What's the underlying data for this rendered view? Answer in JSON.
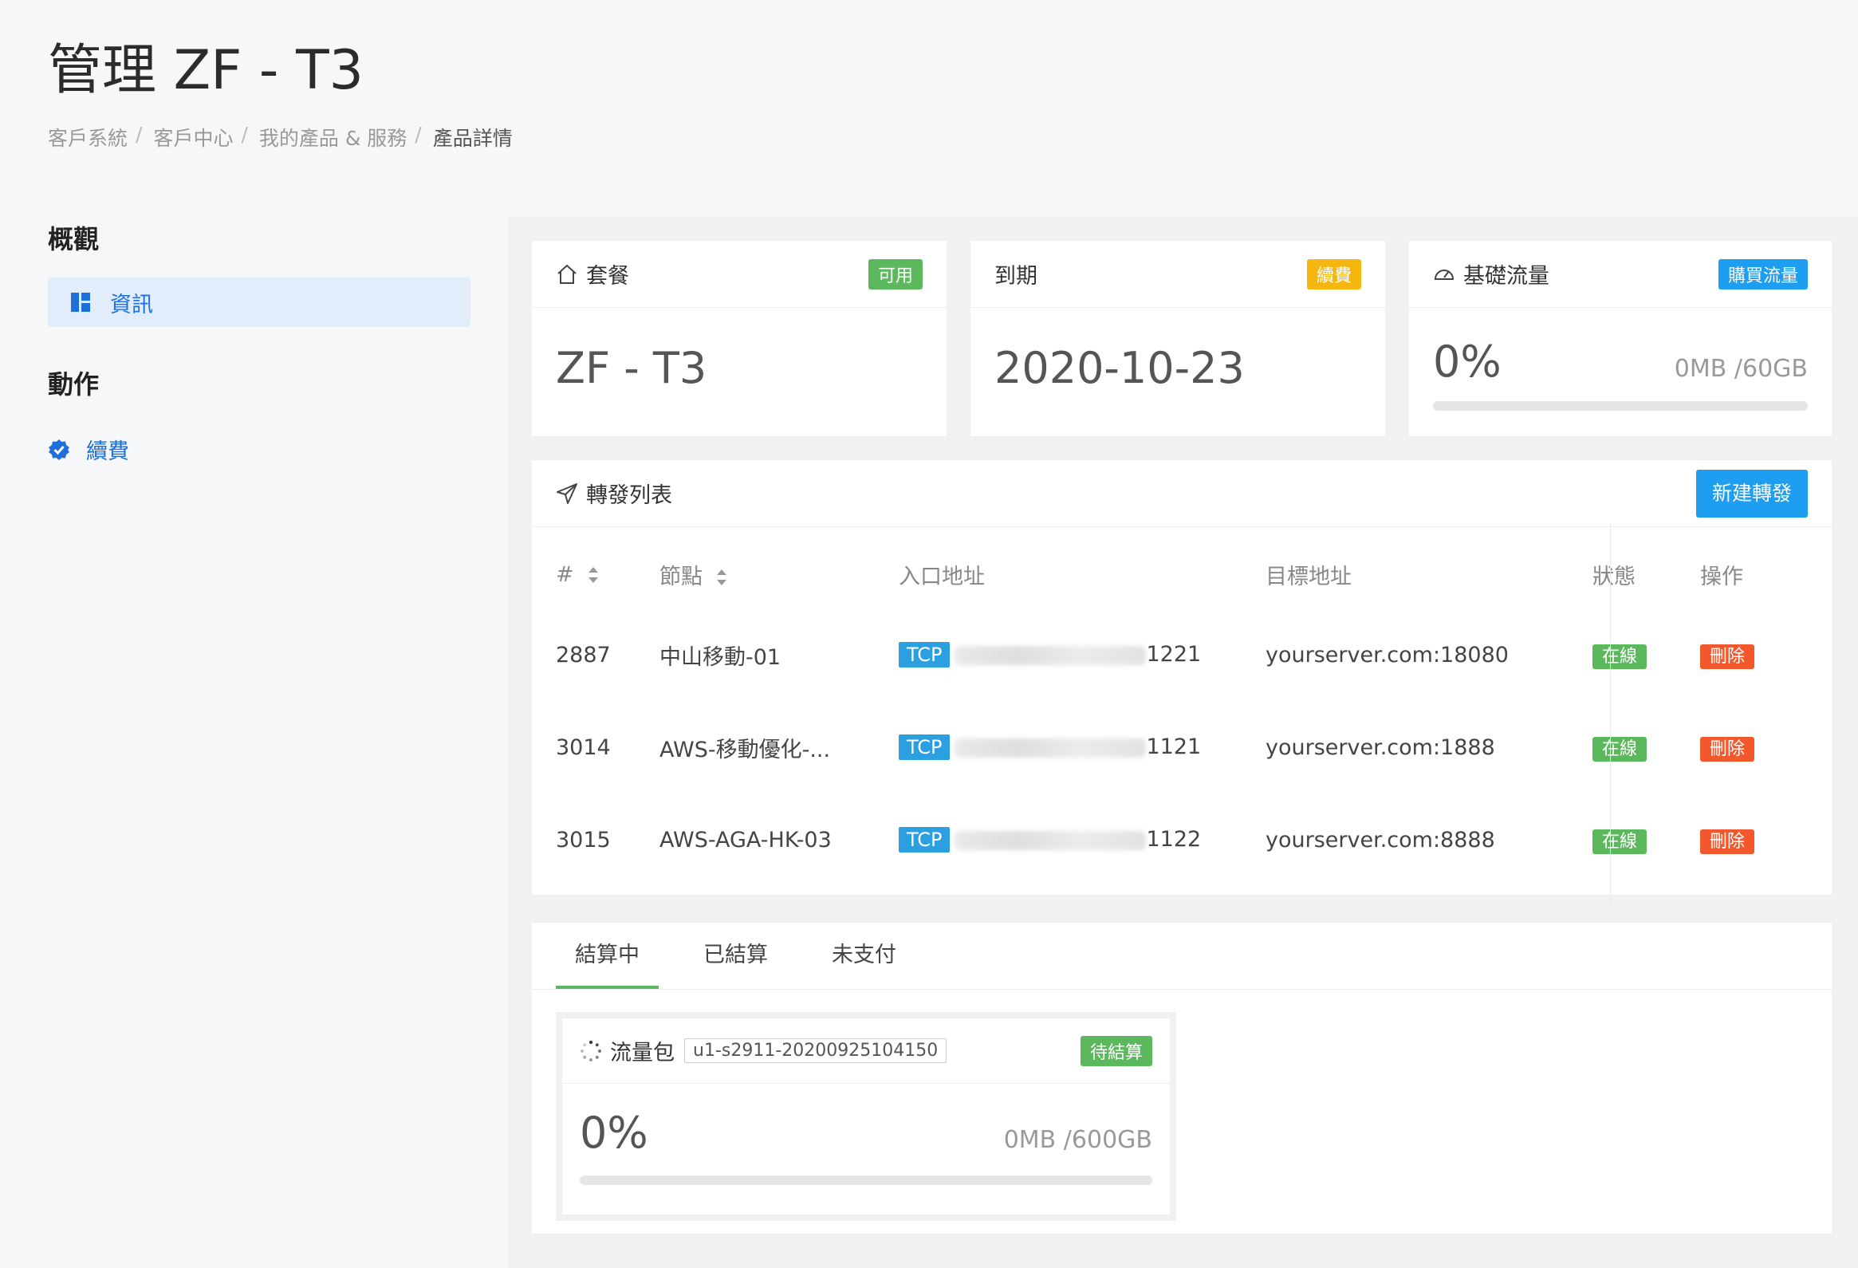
{
  "page": {
    "title": "管理 ZF - T3",
    "breadcrumb": [
      "客戶系統",
      "客戶中心",
      "我的產品 & 服務",
      "產品詳情"
    ]
  },
  "sidebar": {
    "overview_heading": "概觀",
    "info_label": "資訊",
    "actions_heading": "動作",
    "renew_label": "續費"
  },
  "cards": {
    "package": {
      "title": "套餐",
      "badge": "可用",
      "value": "ZF - T3"
    },
    "expiry": {
      "title": "到期",
      "badge": "續費",
      "value": "2020-10-23"
    },
    "traffic": {
      "title": "基礎流量",
      "badge": "購買流量",
      "percent": "0%",
      "usage": "0MB /60GB",
      "progress": 0
    }
  },
  "forward": {
    "title": "轉發列表",
    "new_button": "新建轉發",
    "headers": [
      "#",
      "節點",
      "入口地址",
      "目標地址",
      "狀態",
      "操作"
    ],
    "rows": [
      {
        "id": "2887",
        "node": "中山移動-01",
        "protocol": "TCP",
        "entry_port": "1221",
        "target": "yourserver.com:18080",
        "status": "在線",
        "action": "刪除"
      },
      {
        "id": "3014",
        "node": "AWS-移動優化-...",
        "protocol": "TCP",
        "entry_port": "1121",
        "target": "yourserver.com:1888",
        "status": "在線",
        "action": "刪除"
      },
      {
        "id": "3015",
        "node": "AWS-AGA-HK-03",
        "protocol": "TCP",
        "entry_port": "1122",
        "target": "yourserver.com:8888",
        "status": "在線",
        "action": "刪除"
      }
    ]
  },
  "billing": {
    "tabs": [
      "結算中",
      "已結算",
      "未支付"
    ],
    "package": {
      "label": "流量包",
      "id": "u1-s2911-20200925104150",
      "badge": "待結算",
      "percent": "0%",
      "usage": "0MB /600GB",
      "progress": 0
    }
  },
  "colors": {
    "accent_blue": "#1e9ef1",
    "success_green": "#5cb85c",
    "warning_orange": "#f5b70f",
    "danger_red": "#f2582b"
  }
}
